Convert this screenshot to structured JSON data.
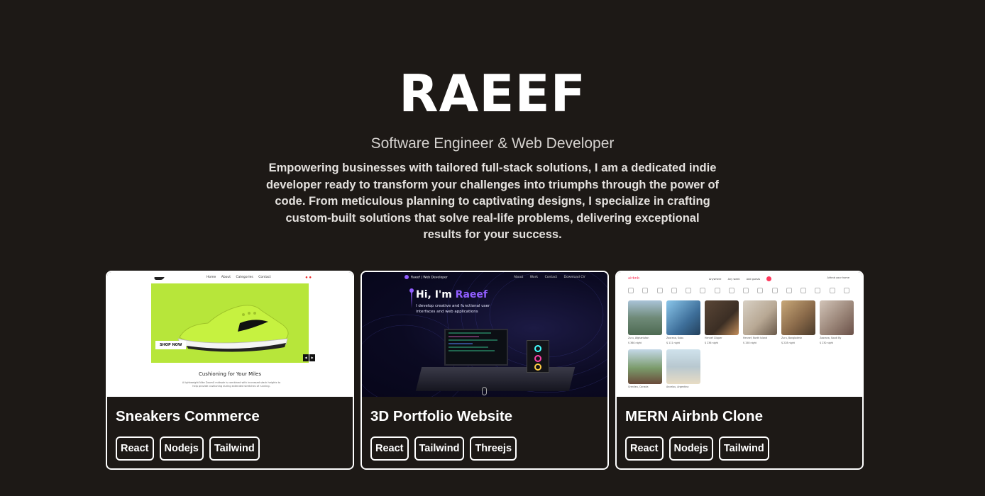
{
  "hero": {
    "name": "RAEEF",
    "subtitle": "Software Engineer & Web Developer",
    "description": "Empowering businesses with tailored full-stack solutions, I am a dedicated indie developer ready to transform your challenges into triumphs through the power of code. From meticulous planning to captivating designs, I specialize in crafting custom-built solutions that solve real-life problems, delivering exceptional results for your success."
  },
  "projects": [
    {
      "title": "Sneakers Commerce",
      "tags": [
        "React",
        "Nodejs",
        "Tailwind"
      ],
      "thumb": {
        "nav_links": [
          "Home",
          "About",
          "Categories",
          "Contact"
        ],
        "button": "SHOP NOW",
        "heading": "Cushioning for Your Miles",
        "text": "A lightweight Nike ZoomX midsole is combined with increased stack heights to help provide cushioning during extended stretches of running."
      }
    },
    {
      "title": "3D Portfolio Website",
      "tags": [
        "React",
        "Tailwind",
        "Threejs"
      ],
      "thumb": {
        "logo": "Raeef | Web Developer",
        "nav_links": [
          "About",
          "Work",
          "Contact",
          "Download CV"
        ],
        "greeting": "Hi, I'm ",
        "greeting_name": "Raeef",
        "tagline": "I develop creative and functional user interfaces and web applications"
      }
    },
    {
      "title": "MERN Airbnb Clone",
      "tags": [
        "React",
        "Nodejs",
        "Tailwind"
      ],
      "thumb": {
        "logo": "airbnb",
        "nav_links": [
          "Anywhere",
          "Any week",
          "Add guests"
        ],
        "user": "Airbnb your home",
        "listings": [
          {
            "place": "Zuru, Afghanistan",
            "price": "$ 360 night",
            "color": "#6f8a78"
          },
          {
            "place": "Zaorana, Kubu",
            "price": "$ 111 night",
            "color": "#3e6f9a"
          },
          {
            "place": "Hennef Clipper",
            "price": "$ 236 night",
            "color": "#3b2e24"
          },
          {
            "place": "Hennef, North Island",
            "price": "$ 158 night",
            "color": "#b8a894"
          },
          {
            "place": "Zuru, Bangladesh",
            "price": "$ 228 night",
            "color": "#8a6a4a"
          },
          {
            "place": "Zaorana, Saudi By",
            "price": "$ 230 night",
            "color": "#9a8578"
          },
          {
            "place": "Grenlieu, Canada",
            "price": "",
            "color": "#7a9a6a"
          },
          {
            "place": "Ancelou, Argentina",
            "price": "",
            "color": "#b8c8d0"
          }
        ]
      }
    }
  ]
}
